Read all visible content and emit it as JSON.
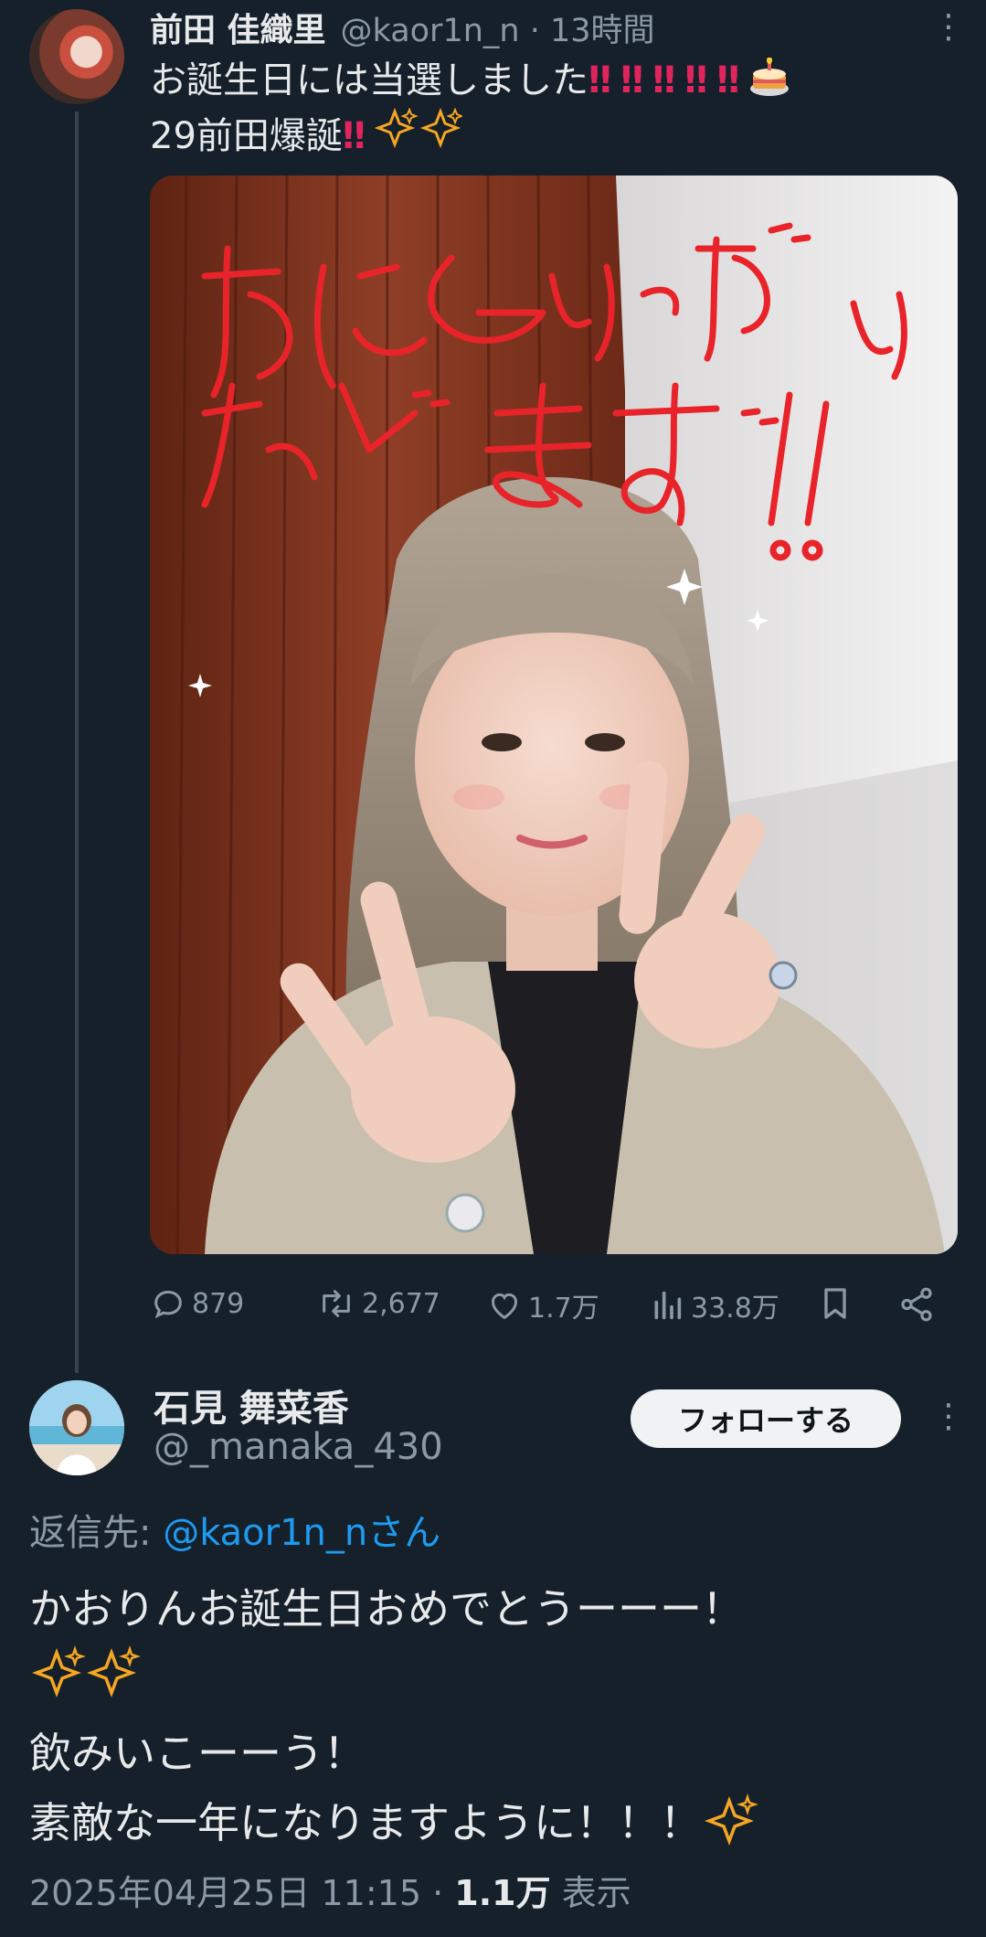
{
  "parent_tweet": {
    "display_name": "前田 佳織里",
    "handle": "@kaor1n_n",
    "separator": "·",
    "time_ago": "13時間",
    "line1_text": "お誕生日には当選しました",
    "line1_emojis": [
      "‼",
      "‼",
      "‼",
      "‼",
      "‼"
    ],
    "line2_text": "29前田爆誕",
    "line2_emojis": [
      "‼"
    ],
    "photo_caption_handwritten": "おにくいっぱいたべます!!",
    "actions": {
      "replies": "879",
      "retweets": "2,677",
      "likes": "1.7万",
      "views": "33.8万"
    }
  },
  "reply_tweet": {
    "display_name": "石見 舞菜香",
    "handle": "@_manaka_430",
    "follow_label": "フォローする",
    "reply_to_prefix": "返信先: ",
    "reply_to_mention": "@kaor1n_nさん",
    "lines": [
      "かおりんお誕生日おめでとうーーー！",
      "飲みいこーーう！",
      "素敵な一年になりますように！！！"
    ],
    "timestamp": "2025年04月25日 11:15",
    "separator": "·",
    "views_count": "1.1万",
    "views_label": "表示"
  },
  "colors": {
    "background": "#15202b",
    "text_primary": "#e7e9ea",
    "text_secondary": "#8b98a5",
    "link": "#1d9bf0",
    "emoji_bang": "#e0245e",
    "sparkle": "#f5a623",
    "thread_line": "#38444d"
  },
  "icons": [
    "more-icon",
    "reply-icon",
    "retweet-icon",
    "like-icon",
    "views-icon",
    "bookmark-icon",
    "share-icon",
    "sparkles-icon",
    "cake-icon",
    "double-exclamation-icon"
  ]
}
